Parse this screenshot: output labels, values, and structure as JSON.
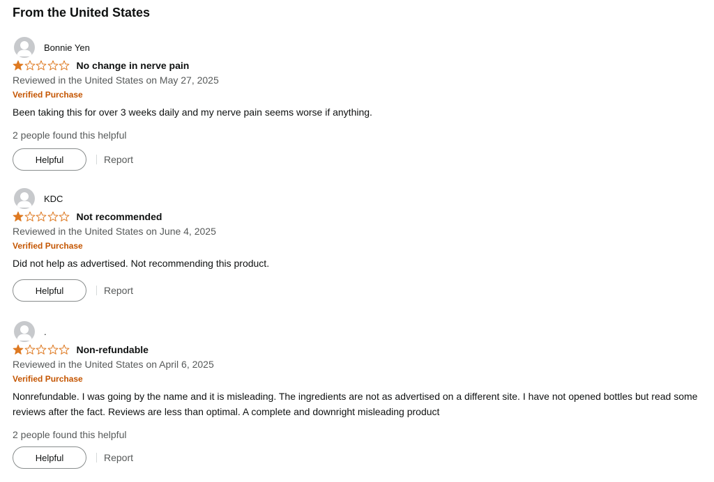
{
  "section": {
    "title": "From the United States"
  },
  "colors": {
    "star_fill": "#de7921",
    "verified": "#c45500",
    "muted_text": "#565959",
    "avatar_bg": "#c7c9cc"
  },
  "reviews": [
    {
      "profile_name": "Bonnie Yen",
      "rating": 1,
      "max_rating": 5,
      "title": "No change in nerve pain",
      "date": "Reviewed in the United States on May 27, 2025",
      "verified": "Verified Purchase",
      "body": "Been taking this for over 3 weeks daily and my nerve pain seems worse if anything.",
      "helpful_count": "2 people found this helpful",
      "helpful_label": "Helpful",
      "report_label": "Report"
    },
    {
      "profile_name": "KDC",
      "rating": 1,
      "max_rating": 5,
      "title": "Not recommended",
      "date": "Reviewed in the United States on June 4, 2025",
      "verified": "Verified Purchase",
      "body": "Did not help as advertised. Not recommending this product.",
      "helpful_count": "",
      "helpful_label": "Helpful",
      "report_label": "Report"
    },
    {
      "profile_name": ".",
      "rating": 1,
      "max_rating": 5,
      "title": "Non-refundable",
      "date": "Reviewed in the United States on April 6, 2025",
      "verified": "Verified Purchase",
      "body": "Nonrefundable. I was going by the name and it is misleading. The ingredients are not as advertised on a different site. I have not opened bottles but read some reviews after the fact. Reviews are less than optimal. A complete and downright misleading product",
      "helpful_count": "2 people found this helpful",
      "helpful_label": "Helpful",
      "report_label": "Report"
    }
  ]
}
